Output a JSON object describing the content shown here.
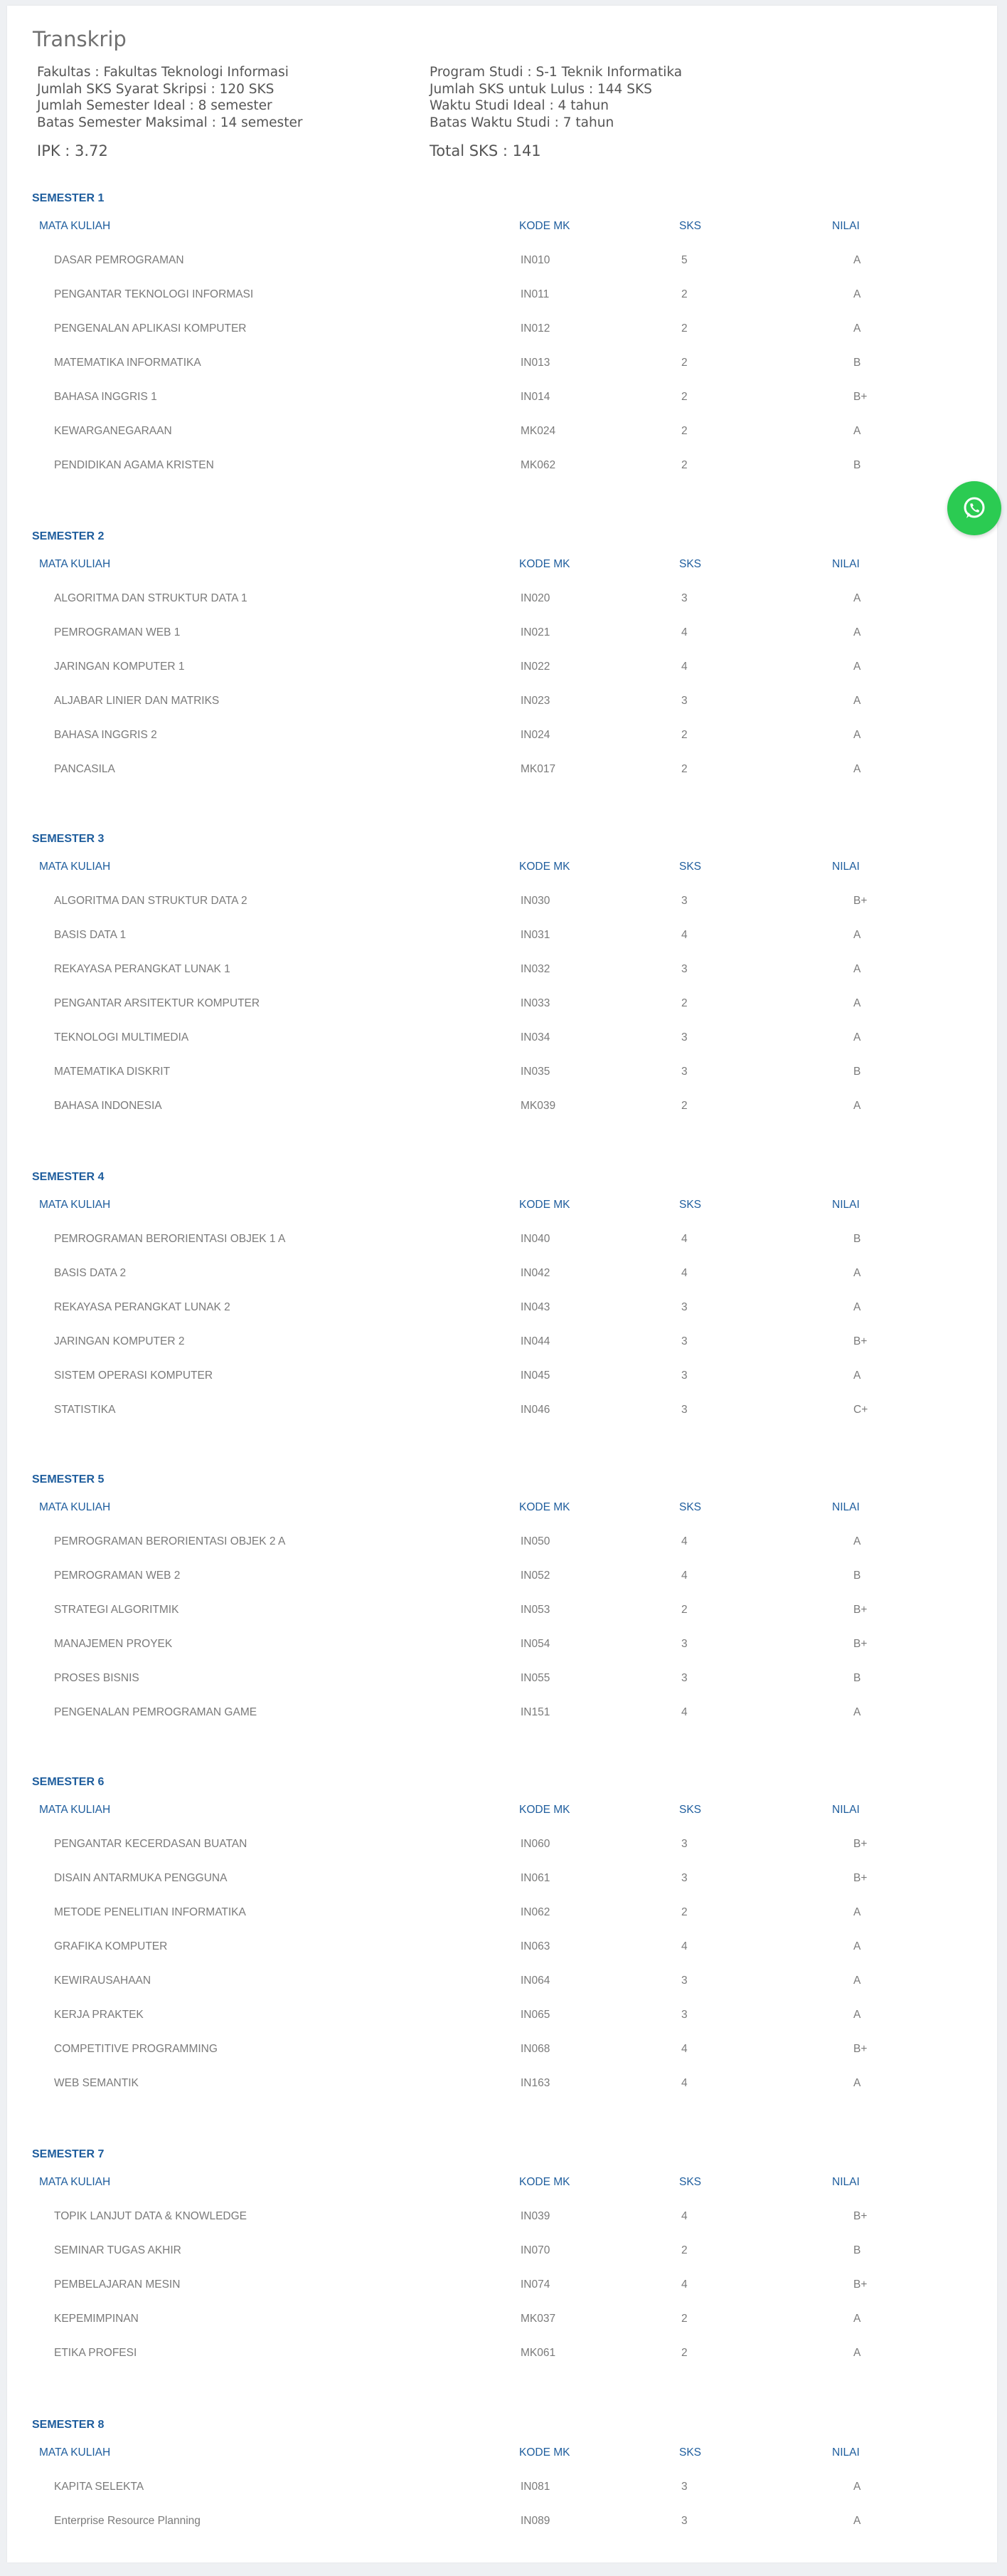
{
  "page": {
    "title": "Transkrip",
    "info_left": [
      "Fakultas : Fakultas Teknologi Informasi",
      "Jumlah SKS Syarat Skripsi : 120 SKS",
      "Jumlah Semester Ideal : 8 semester",
      "Batas Semester Maksimal : 14 semester"
    ],
    "info_right": [
      "Program Studi : S-1 Teknik Informatika",
      "Jumlah SKS untuk Lulus : 144 SKS",
      "Waktu Studi Ideal : 4 tahun",
      "Batas Waktu Studi : 7 tahun"
    ],
    "ipk": "IPK : 3.72",
    "total_sks": "Total SKS : 141"
  },
  "table_headers": {
    "name": "MATA KULIAH",
    "kode": "KODE MK",
    "sks": "SKS",
    "nilai": "NILAI"
  },
  "whatsapp_icon": "whatsapp-icon",
  "colors": {
    "accent": "#1e5d9d",
    "whatsapp": "#2bcb52",
    "text": "#7a7a7a"
  },
  "semesters": [
    {
      "title": "SEMESTER 1",
      "courses": [
        [
          "DASAR PEMROGRAMAN",
          "IN010",
          "5",
          "A"
        ],
        [
          "PENGANTAR TEKNOLOGI INFORMASI",
          "IN011",
          "2",
          "A"
        ],
        [
          "PENGENALAN APLIKASI KOMPUTER",
          "IN012",
          "2",
          "A"
        ],
        [
          "MATEMATIKA INFORMATIKA",
          "IN013",
          "2",
          "B"
        ],
        [
          "BAHASA INGGRIS 1",
          "IN014",
          "2",
          "B+"
        ],
        [
          "KEWARGANEGARAAN",
          "MK024",
          "2",
          "A"
        ],
        [
          "PENDIDIKAN AGAMA KRISTEN",
          "MK062",
          "2",
          "B"
        ]
      ]
    },
    {
      "title": "SEMESTER 2",
      "courses": [
        [
          "ALGORITMA DAN STRUKTUR DATA 1",
          "IN020",
          "3",
          "A"
        ],
        [
          "PEMROGRAMAN WEB 1",
          "IN021",
          "4",
          "A"
        ],
        [
          "JARINGAN KOMPUTER 1",
          "IN022",
          "4",
          "A"
        ],
        [
          "ALJABAR LINIER DAN MATRIKS",
          "IN023",
          "3",
          "A"
        ],
        [
          "BAHASA INGGRIS 2",
          "IN024",
          "2",
          "A"
        ],
        [
          "PANCASILA",
          "MK017",
          "2",
          "A"
        ]
      ]
    },
    {
      "title": "SEMESTER 3",
      "courses": [
        [
          "ALGORITMA DAN STRUKTUR DATA 2",
          "IN030",
          "3",
          "B+"
        ],
        [
          "BASIS DATA 1",
          "IN031",
          "4",
          "A"
        ],
        [
          "REKAYASA PERANGKAT LUNAK 1",
          "IN032",
          "3",
          "A"
        ],
        [
          "PENGANTAR ARSITEKTUR KOMPUTER",
          "IN033",
          "2",
          "A"
        ],
        [
          "TEKNOLOGI MULTIMEDIA",
          "IN034",
          "3",
          "A"
        ],
        [
          "MATEMATIKA DISKRIT",
          "IN035",
          "3",
          "B"
        ],
        [
          "BAHASA INDONESIA",
          "MK039",
          "2",
          "A"
        ]
      ]
    },
    {
      "title": "SEMESTER 4",
      "courses": [
        [
          "PEMROGRAMAN BERORIENTASI OBJEK 1 A",
          "IN040",
          "4",
          "B"
        ],
        [
          "BASIS DATA 2",
          "IN042",
          "4",
          "A"
        ],
        [
          "REKAYASA PERANGKAT LUNAK 2",
          "IN043",
          "3",
          "A"
        ],
        [
          "JARINGAN KOMPUTER 2",
          "IN044",
          "3",
          "B+"
        ],
        [
          "SISTEM OPERASI KOMPUTER",
          "IN045",
          "3",
          "A"
        ],
        [
          "STATISTIKA",
          "IN046",
          "3",
          "C+"
        ]
      ]
    },
    {
      "title": "SEMESTER 5",
      "courses": [
        [
          "PEMROGRAMAN BERORIENTASI OBJEK 2 A",
          "IN050",
          "4",
          "A"
        ],
        [
          "PEMROGRAMAN WEB 2",
          "IN052",
          "4",
          "B"
        ],
        [
          "STRATEGI ALGORITMIK",
          "IN053",
          "2",
          "B+"
        ],
        [
          "MANAJEMEN PROYEK",
          "IN054",
          "3",
          "B+"
        ],
        [
          "PROSES BISNIS",
          "IN055",
          "3",
          "B"
        ],
        [
          "PENGENALAN PEMROGRAMAN GAME",
          "IN151",
          "4",
          "A"
        ]
      ]
    },
    {
      "title": "SEMESTER 6",
      "courses": [
        [
          "PENGANTAR KECERDASAN BUATAN",
          "IN060",
          "3",
          "B+"
        ],
        [
          "DISAIN ANTARMUKA PENGGUNA",
          "IN061",
          "3",
          "B+"
        ],
        [
          "METODE PENELITIAN INFORMATIKA",
          "IN062",
          "2",
          "A"
        ],
        [
          "GRAFIKA KOMPUTER",
          "IN063",
          "4",
          "A"
        ],
        [
          "KEWIRAUSAHAAN",
          "IN064",
          "3",
          "A"
        ],
        [
          "KERJA PRAKTEK",
          "IN065",
          "3",
          "A"
        ],
        [
          "COMPETITIVE PROGRAMMING",
          "IN068",
          "4",
          "B+"
        ],
        [
          "WEB SEMANTIK",
          "IN163",
          "4",
          "A"
        ]
      ]
    },
    {
      "title": "SEMESTER 7",
      "courses": [
        [
          "TOPIK LANJUT DATA & KNOWLEDGE",
          "IN039",
          "4",
          "B+"
        ],
        [
          "SEMINAR TUGAS AKHIR",
          "IN070",
          "2",
          "B"
        ],
        [
          "PEMBELAJARAN MESIN",
          "IN074",
          "4",
          "B+"
        ],
        [
          "KEPEMIMPINAN",
          "MK037",
          "2",
          "A"
        ],
        [
          "ETIKA PROFESI",
          "MK061",
          "2",
          "A"
        ]
      ]
    },
    {
      "title": "SEMESTER 8",
      "courses": [
        [
          "KAPITA SELEKTA",
          "IN081",
          "3",
          "A"
        ],
        [
          "Enterprise Resource Planning",
          "IN089",
          "3",
          "A"
        ]
      ]
    }
  ]
}
